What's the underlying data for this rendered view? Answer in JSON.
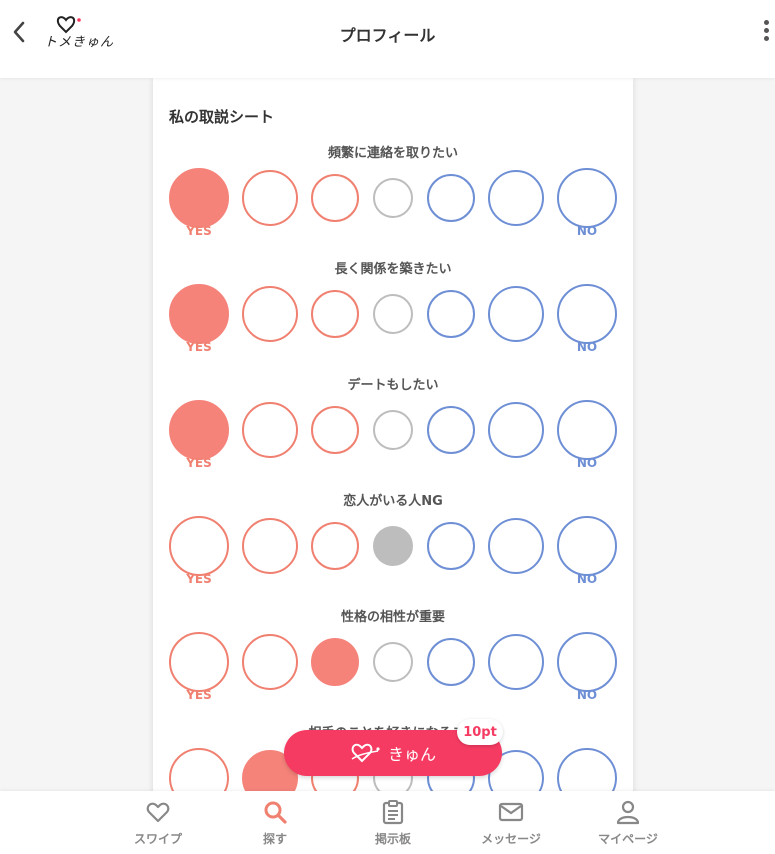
{
  "header": {
    "title": "プロフィール",
    "logo_text": "トメきゅん"
  },
  "card": {
    "section_title": "私の取説シート",
    "yes_label": "YES",
    "no_label": "NO",
    "questions": [
      {
        "label": "頻繁に連絡を取りたい",
        "selected": 0
      },
      {
        "label": "長く関係を築きたい",
        "selected": 0
      },
      {
        "label": "デートもしたい",
        "selected": 0
      },
      {
        "label": "恋人がいる人NG",
        "selected": 3
      },
      {
        "label": "性格の相性が重要",
        "selected": 2
      },
      {
        "label": "相手のことを好きになること",
        "selected": 1
      }
    ]
  },
  "kyun_button": {
    "label": "きゅん",
    "badge": "10pt"
  },
  "bottom_nav": {
    "items": [
      {
        "label": "スワイプ",
        "icon": "heart-icon"
      },
      {
        "label": "探す",
        "icon": "search-icon"
      },
      {
        "label": "掲示板",
        "icon": "clipboard-icon"
      },
      {
        "label": "メッセージ",
        "icon": "mail-icon"
      },
      {
        "label": "マイページ",
        "icon": "person-icon"
      }
    ],
    "active_index": 1
  },
  "colors": {
    "yes": "#f08070",
    "no": "#6e8fd5",
    "neutral": "#bdbdbd",
    "accent": "#f53b62",
    "active_nav": "#f08070"
  }
}
